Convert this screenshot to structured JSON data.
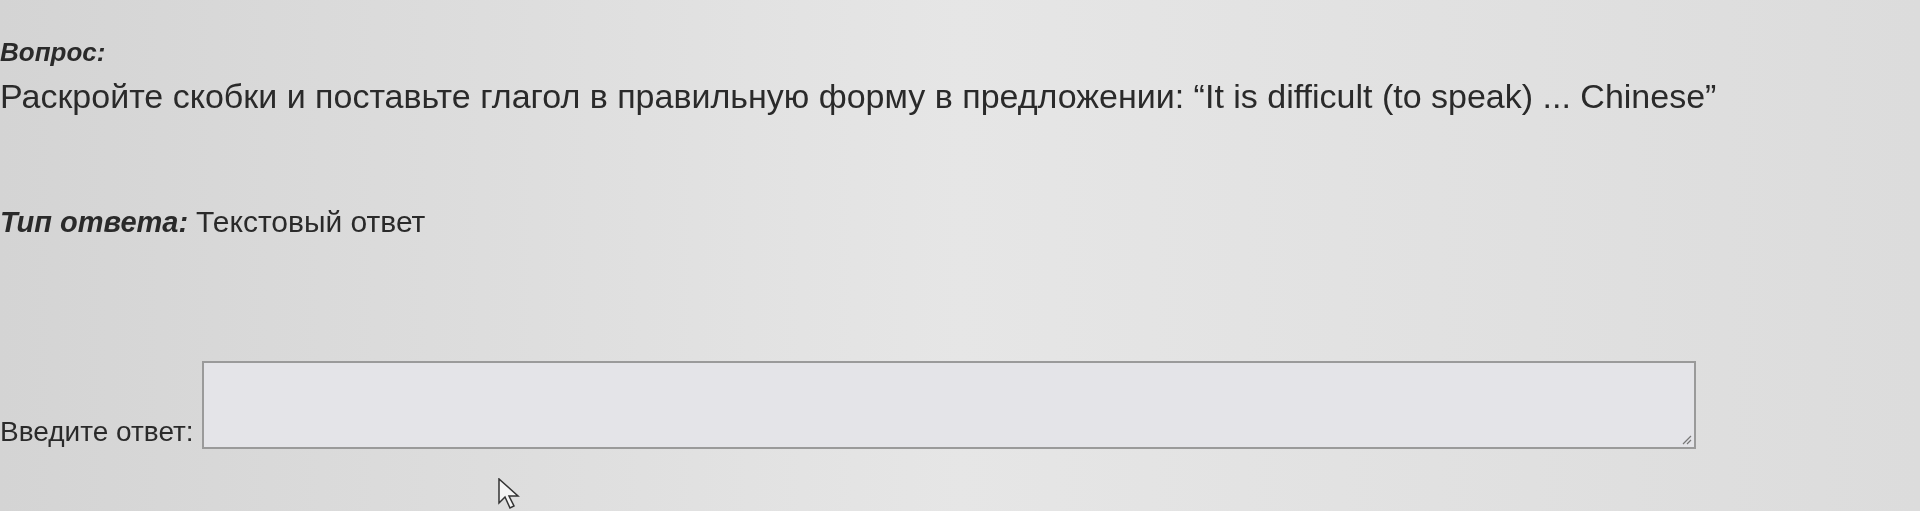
{
  "question": {
    "label": "Вопрос:",
    "text": "Раскройте скобки и поставьте глагол в правильную форму в предложении: “It is difficult (to speak) ... Chinese”"
  },
  "answer_type": {
    "label": "Тип ответа:",
    "value": "Текстовый ответ"
  },
  "answer": {
    "label": "Введите ответ:"
  }
}
